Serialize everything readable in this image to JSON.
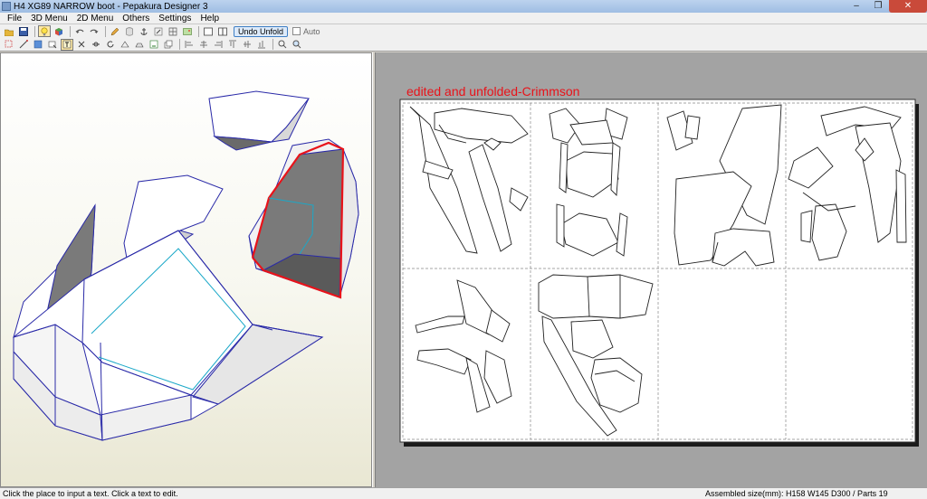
{
  "window": {
    "title": "H4 XG89 NARROW boot - Pepakura Designer 3"
  },
  "menubar": {
    "items": [
      "File",
      "3D Menu",
      "2D Menu",
      "Others",
      "Settings",
      "Help"
    ]
  },
  "toolbar": {
    "undo_unfold_label": "Undo Unfold",
    "auto_label": "Auto",
    "auto_checked": false,
    "row1_icons": [
      "open-icon",
      "save-icon",
      "lightbulb-icon",
      "cube-icon",
      "undo-icon",
      "redo-icon",
      "pencil-icon",
      "cylinder-icon",
      "anchor-icon",
      "rotate-icon",
      "grid-icon",
      "image-icon",
      "single-view-icon",
      "dual-view-icon"
    ],
    "row2_icons": [
      "select-icon",
      "edge-icon",
      "texture-icon",
      "move-icon",
      "cut-icon",
      "join-icon",
      "rotate-part-icon",
      "fold-icon",
      "flap-icon",
      "text-icon",
      "align-icon",
      "arrange-icon",
      "zoom-icon",
      "fit-icon"
    ]
  },
  "canvas2d": {
    "page_text": "edited and unfolded-Crimmson"
  },
  "statusbar": {
    "hint": "Click the place to input a text. Click a text to edit.",
    "info": "Assembled size(mm): H158 W145 D300 / Parts 19"
  },
  "colors": {
    "titlebar": "#9fbde3",
    "selection_edge": "#e8131a",
    "mesh_edge": "#2a2aa8",
    "page_text": "#e8131a"
  }
}
